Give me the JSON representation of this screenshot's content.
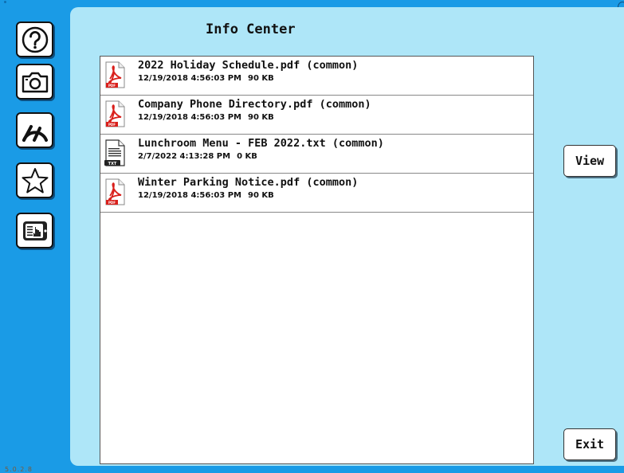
{
  "title": "Info Center",
  "version": "5.0.2.8",
  "sidebar": {
    "items": [
      {
        "name": "help",
        "icon": "help-icon"
      },
      {
        "name": "camera",
        "icon": "camera-icon"
      },
      {
        "name": "speedometer",
        "icon": "speedometer-icon"
      },
      {
        "name": "favorites",
        "icon": "star-icon"
      },
      {
        "name": "info-center",
        "icon": "touch-document-icon"
      }
    ]
  },
  "files": [
    {
      "name": "2022 Holiday Schedule.pdf (common)",
      "date": "12/19/2018 4:56:03 PM",
      "size": "90 KB",
      "type": "pdf",
      "type_label": "PDF"
    },
    {
      "name": "Company Phone Directory.pdf (common)",
      "date": "12/19/2018 4:56:03 PM",
      "size": "90 KB",
      "type": "pdf",
      "type_label": "PDF"
    },
    {
      "name": "Lunchroom Menu - FEB 2022.txt (common)",
      "date": "2/7/2022 4:13:28 PM",
      "size": "0 KB",
      "type": "txt",
      "type_label": "TXT"
    },
    {
      "name": "Winter Parking Notice.pdf (common)",
      "date": "12/19/2018 4:56:03 PM",
      "size": "90 KB",
      "type": "pdf",
      "type_label": "PDF"
    }
  ],
  "buttons": {
    "view": "View",
    "exit": "Exit"
  },
  "colors": {
    "frame": "#1a9be6",
    "panel": "#aee6f8",
    "pdf_red": "#d9201c"
  }
}
